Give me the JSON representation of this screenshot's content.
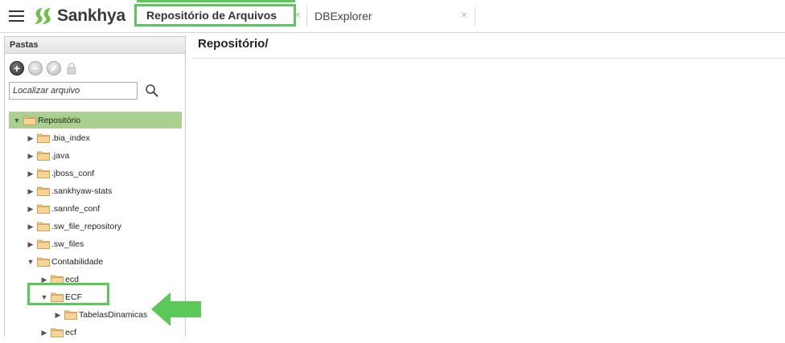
{
  "app": {
    "brand": "Sankhya"
  },
  "tabs": [
    {
      "label": "Repositório de Arquivos",
      "active": true,
      "close": "×"
    },
    {
      "label": "DBExplorer",
      "active": false,
      "close": "×"
    }
  ],
  "sidebar": {
    "title": "Pastas",
    "toolbar": {
      "add": "+",
      "remove": "−"
    },
    "search": {
      "placeholder": "Localizar arquivo",
      "value": ""
    },
    "tree": [
      {
        "label": "Repositório",
        "expanded": true,
        "selected": true
      },
      {
        "label": ".bia_index",
        "expanded": false
      },
      {
        "label": ".java",
        "expanded": false
      },
      {
        "label": ".jboss_conf",
        "expanded": false
      },
      {
        "label": ".sankhyaw-stats",
        "expanded": false
      },
      {
        "label": ".sannfe_conf",
        "expanded": false
      },
      {
        "label": ".sw_file_repository",
        "expanded": false
      },
      {
        "label": ".sw_files",
        "expanded": false
      },
      {
        "label": "Contabilidade",
        "expanded": true
      },
      {
        "label": "ecd",
        "expanded": false
      },
      {
        "label": "ECF",
        "expanded": true
      },
      {
        "label": "TabelasDinamicas",
        "expanded": false
      },
      {
        "label": "ecf",
        "expanded": false
      }
    ]
  },
  "main": {
    "title": "Repositório/"
  },
  "colors": {
    "accent_green": "#5bc85a",
    "selected_row": "#a9d08e",
    "logo_green": "#6cc04a"
  }
}
